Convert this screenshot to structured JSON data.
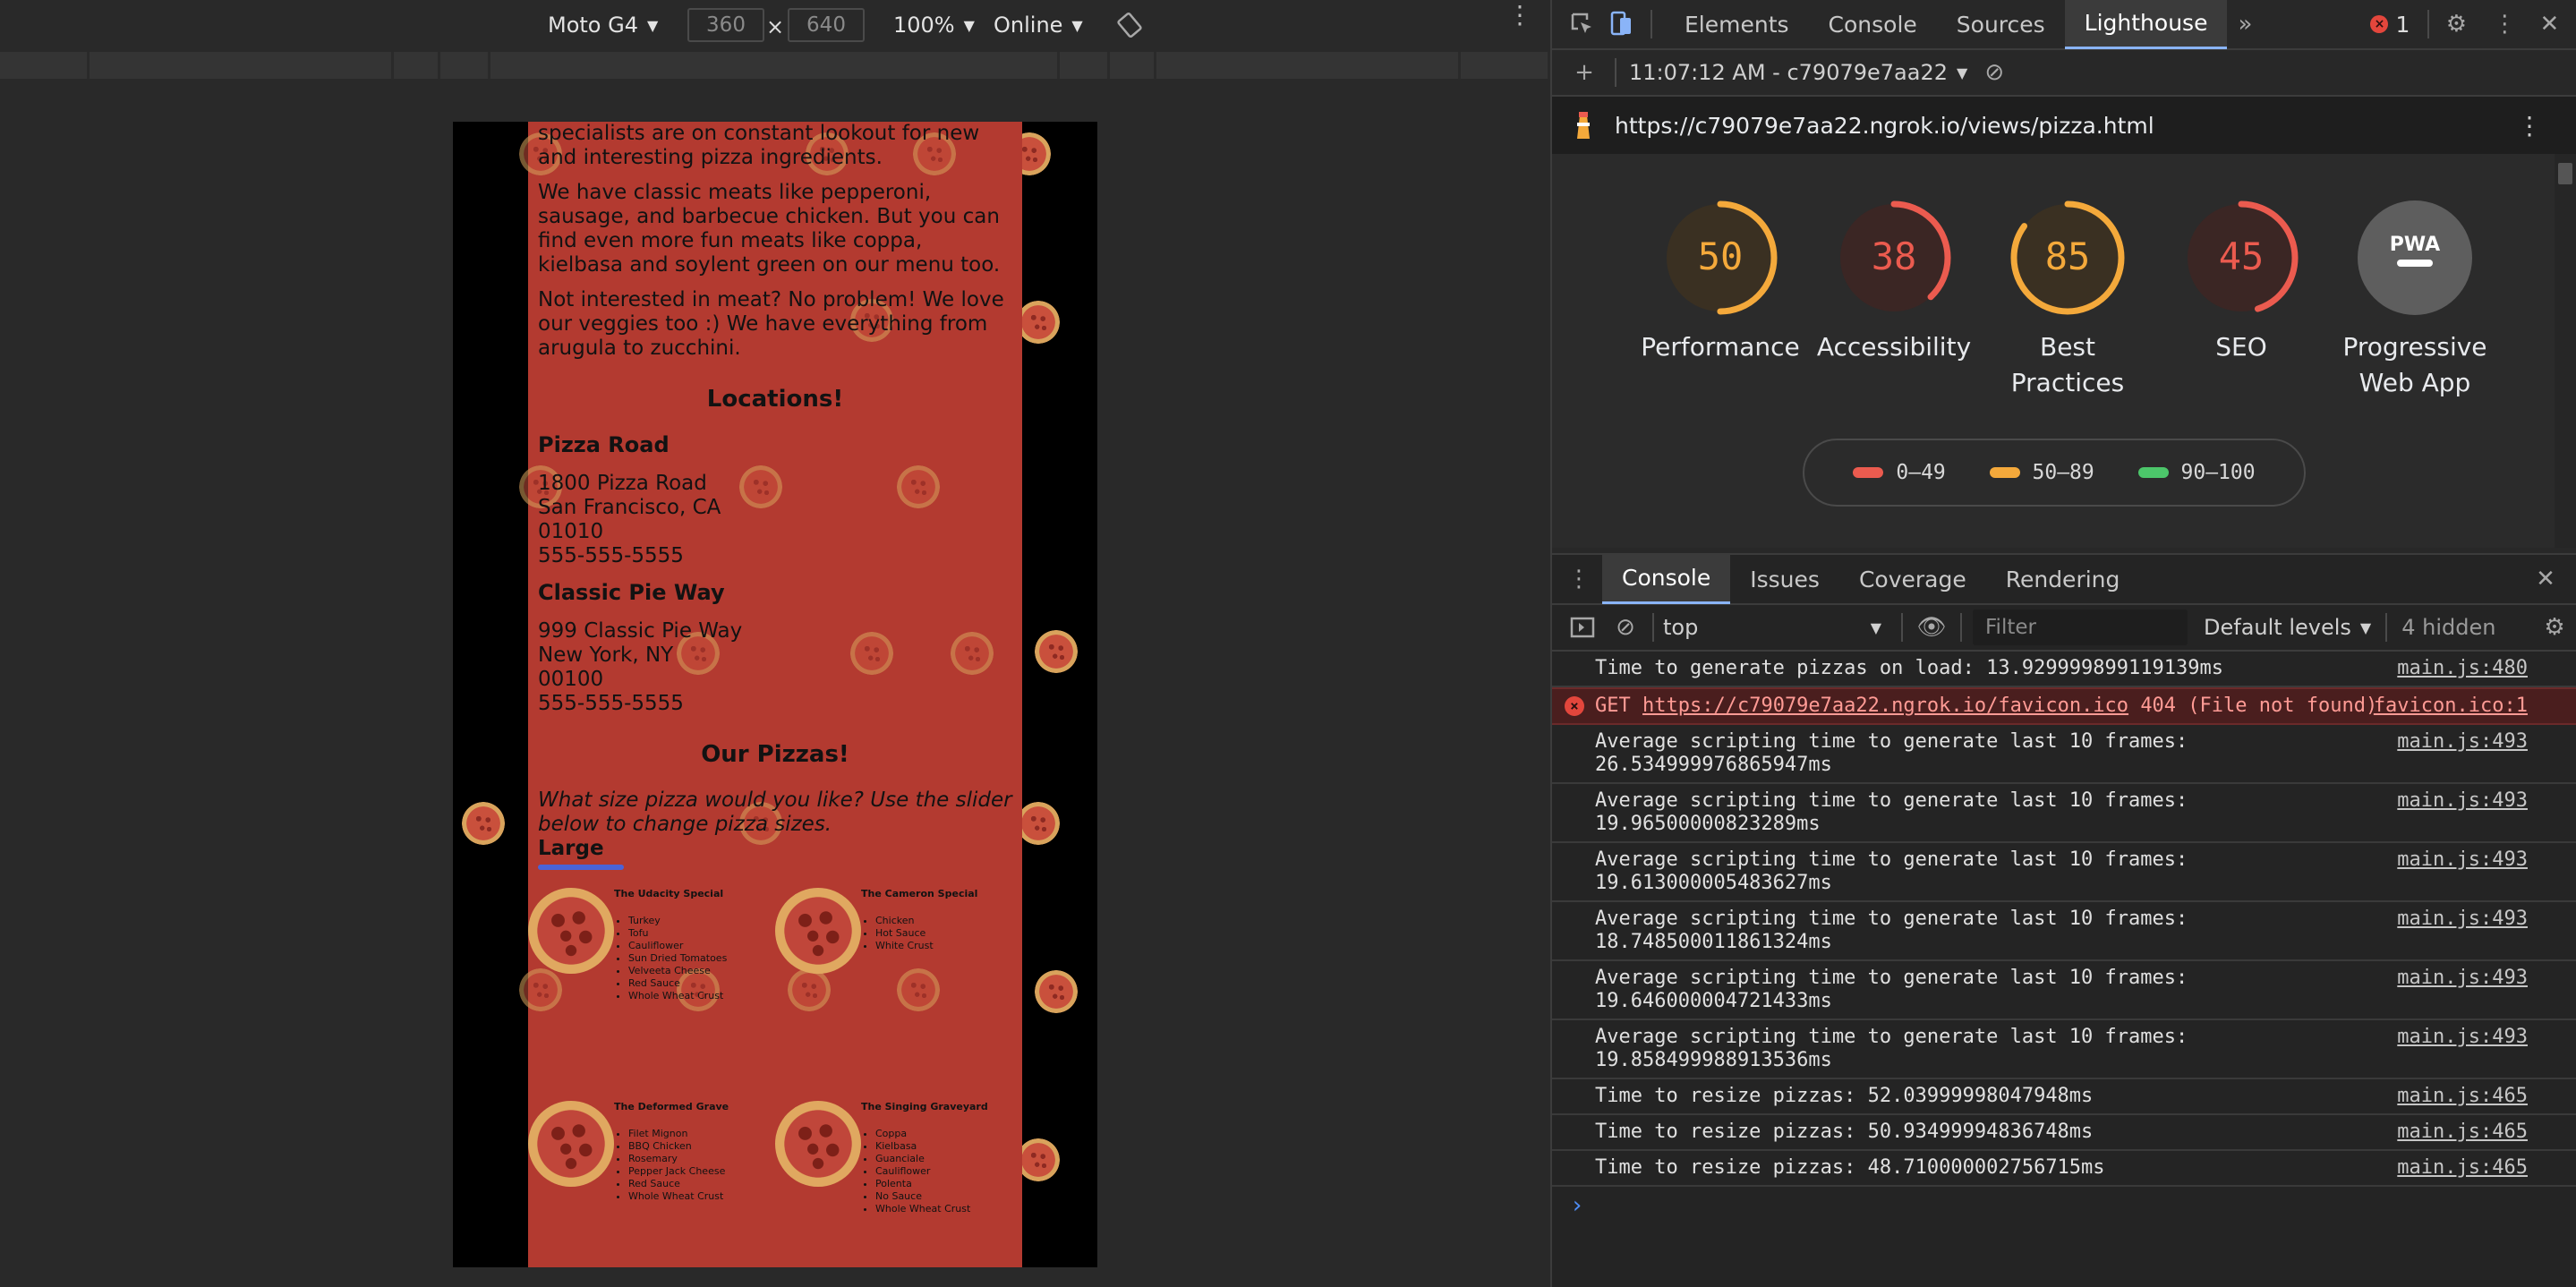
{
  "device_toolbar": {
    "device": "Moto G4",
    "width": "360",
    "height": "640",
    "zoom": "100%",
    "network": "Online"
  },
  "page": {
    "para1": "specialists are on constant lookout for new and interesting pizza ingredients.",
    "para2": "We have classic meats like pepperoni, sausage, and barbecue chicken. But you can find even more fun meats like coppa, kielbasa and soylent green on our menu too.",
    "para3": "Not interested in meat? No problem! We love our veggies too :) We have everything from arugula to zucchini.",
    "locations_heading": "Locations!",
    "loc1_name": "Pizza Road",
    "loc1_lines": [
      "1800 Pizza Road",
      "San Francisco, CA",
      "01010",
      "555-555-5555"
    ],
    "loc2_name": "Classic Pie Way",
    "loc2_lines": [
      "999 Classic Pie Way",
      "New York, NY",
      "00100",
      "555-555-5555"
    ],
    "pizzas_heading": "Our Pizzas!",
    "size_prompt": "What size pizza would you like? Use the slider below to change pizza sizes.",
    "size_value": "Large",
    "pizzas": [
      {
        "name": "The Udacity Special",
        "ingredients": [
          "Turkey",
          "Tofu",
          "Cauliflower",
          "Sun Dried Tomatoes",
          "Velveeta Cheese",
          "Red Sauce",
          "Whole Wheat Crust"
        ]
      },
      {
        "name": "The Cameron Special",
        "ingredients": [
          "Chicken",
          "Hot Sauce",
          "White Crust"
        ]
      },
      {
        "name": "The Deformed Grave",
        "ingredients": [
          "Filet Mignon",
          "BBQ Chicken",
          "Rosemary",
          "Pepper Jack Cheese",
          "Red Sauce",
          "Whole Wheat Crust"
        ]
      },
      {
        "name": "The Singing Graveyard",
        "ingredients": [
          "Coppa",
          "Kielbasa",
          "Guanciale",
          "Cauliflower",
          "Polenta",
          "No Sauce",
          "Whole Wheat Crust"
        ]
      }
    ]
  },
  "devtools": {
    "tabs": [
      "Elements",
      "Console",
      "Sources",
      "Lighthouse"
    ],
    "active_tab": "Lighthouse",
    "error_count": "1",
    "lighthouse": {
      "report_label": "11:07:12 AM - c79079e7aa22",
      "url": "https://c79079e7aa22.ngrok.io/views/pizza.html",
      "scores": [
        {
          "label": "Performance",
          "value": 50,
          "color": "#f4a93b"
        },
        {
          "label": "Accessibility",
          "value": 38,
          "color": "#eb5b4f"
        },
        {
          "label": "Best Practices",
          "value": 85,
          "color": "#f4a93b"
        },
        {
          "label": "SEO",
          "value": 45,
          "color": "#eb5b4f"
        },
        {
          "label": "Progressive Web App",
          "value": null,
          "color": "#9aa0a6"
        }
      ],
      "pwa_badge": "PWA",
      "legend": [
        {
          "range": "0–49",
          "color": "#eb5b4f"
        },
        {
          "range": "50–89",
          "color": "#f4a93b"
        },
        {
          "range": "90–100",
          "color": "#4cc66a"
        }
      ]
    },
    "drawer_tabs": [
      "Console",
      "Issues",
      "Coverage",
      "Rendering"
    ],
    "console": {
      "context": "top",
      "filter_placeholder": "Filter",
      "levels": "Default levels",
      "hidden": "4 hidden",
      "messages": [
        {
          "text": "Time to generate pizzas on load: 13.929999899119139ms",
          "source": "main.js:480"
        },
        {
          "source": "favicon.ico:1"
        },
        {
          "text": "Average scripting time to generate last 10 frames: 26.534999976865947ms",
          "source": "main.js:493"
        },
        {
          "text": "Average scripting time to generate last 10 frames: 19.96500000823289ms",
          "source": "main.js:493"
        },
        {
          "text": "Average scripting time to generate last 10 frames: 19.613000005483627ms",
          "source": "main.js:493"
        },
        {
          "text": "Average scripting time to generate last 10 frames: 18.748500011861324ms",
          "source": "main.js:493"
        },
        {
          "text": "Average scripting time to generate last 10 frames: 19.646000004721433ms",
          "source": "main.js:493"
        },
        {
          "text": "Average scripting time to generate last 10 frames: 19.858499988913536ms",
          "source": "main.js:493"
        },
        {
          "text": "Time to resize pizzas: 52.03999998047948ms",
          "source": "main.js:465"
        },
        {
          "text": "Time to resize pizzas: 50.93499994836748ms",
          "source": "main.js:465"
        },
        {
          "text": "Time to resize pizzas: 48.710000002756715ms",
          "source": "main.js:465"
        }
      ],
      "error": {
        "method": "GET",
        "url": "https://c79079e7aa22.ngrok.io/favicon.ico",
        "status": "404 (File not found)"
      },
      "prompt": "›"
    }
  }
}
